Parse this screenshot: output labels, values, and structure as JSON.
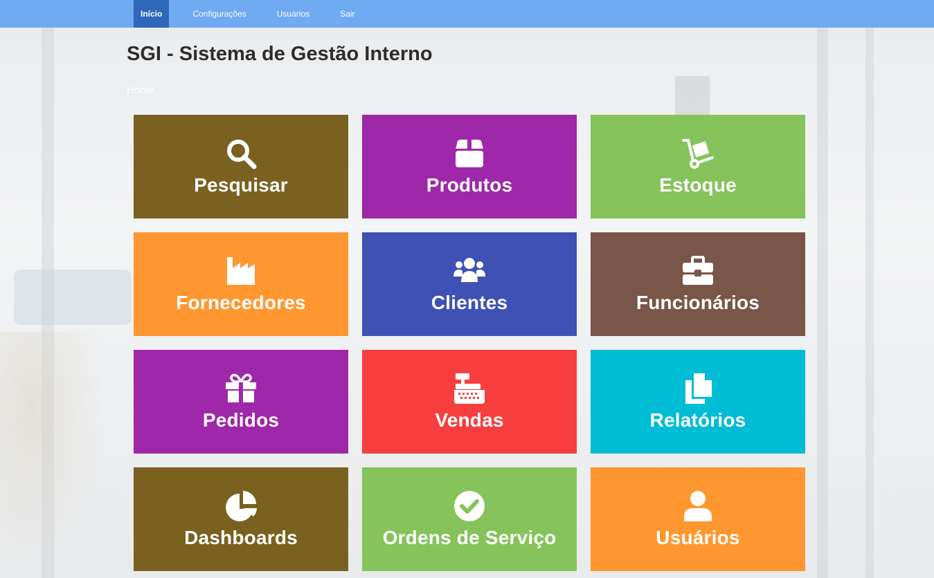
{
  "nav": {
    "items": [
      {
        "label": "Início",
        "active": true
      },
      {
        "label": "Configurações",
        "active": false
      },
      {
        "label": "Usuários",
        "active": false
      },
      {
        "label": "Sair",
        "active": false
      }
    ]
  },
  "header": {
    "title": "SGI - Sistema de Gestão Interno",
    "breadcrumb": "Home"
  },
  "colors": {
    "nav_bg": "#6faaf3",
    "nav_active": "#2f68ba",
    "olive": "#7a6120",
    "purple": "#9f27a9",
    "green": "#86c35b",
    "orange": "#ff9730",
    "indigo": "#3f51b3",
    "brown": "#79554a",
    "red": "#f73e3e",
    "cyan": "#00bcd4"
  },
  "tiles": [
    {
      "label": "Pesquisar",
      "icon": "search-icon",
      "color": "#7a6120"
    },
    {
      "label": "Produtos",
      "icon": "box-icon",
      "color": "#9f27a9"
    },
    {
      "label": "Estoque",
      "icon": "dolly-icon",
      "color": "#86c35b"
    },
    {
      "label": "Fornecedores",
      "icon": "industry-icon",
      "color": "#ff9730"
    },
    {
      "label": "Clientes",
      "icon": "users-icon",
      "color": "#3f51b3"
    },
    {
      "label": "Funcionários",
      "icon": "toolbox-icon",
      "color": "#79554a"
    },
    {
      "label": "Pedidos",
      "icon": "gift-icon",
      "color": "#9f27a9"
    },
    {
      "label": "Vendas",
      "icon": "cash-register-icon",
      "color": "#f73e3e"
    },
    {
      "label": "Relatórios",
      "icon": "copy-icon",
      "color": "#00bcd4"
    },
    {
      "label": "Dashboards",
      "icon": "pie-chart-icon",
      "color": "#7a6120"
    },
    {
      "label": "Ordens de Serviço",
      "icon": "check-circle-icon",
      "color": "#86c35b"
    },
    {
      "label": "Usuários",
      "icon": "user-icon",
      "color": "#ff9730"
    }
  ]
}
